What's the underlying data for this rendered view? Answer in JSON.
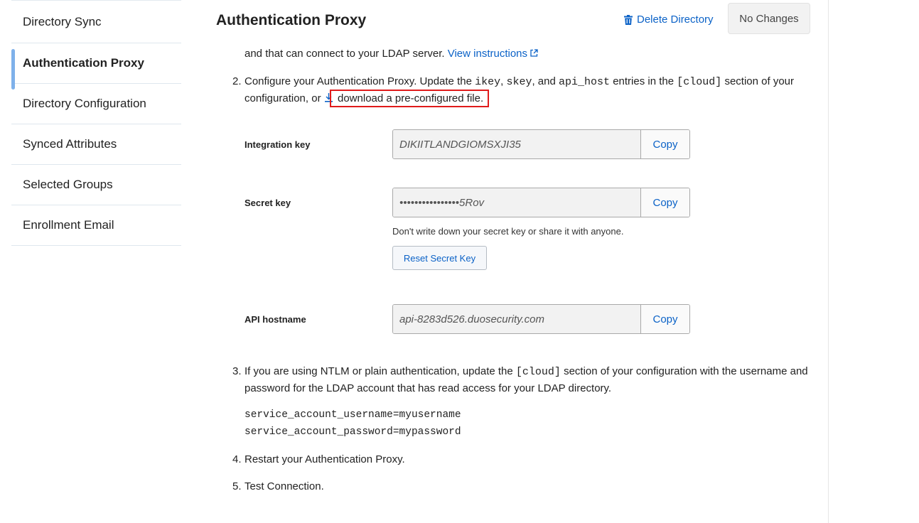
{
  "sidebar": {
    "items": [
      {
        "label": "Directory Sync"
      },
      {
        "label": "Authentication Proxy"
      },
      {
        "label": "Directory Configuration"
      },
      {
        "label": "Synced Attributes"
      },
      {
        "label": "Selected Groups"
      },
      {
        "label": "Enrollment Email"
      }
    ],
    "active_index": 1
  },
  "header": {
    "title": "Authentication Proxy",
    "delete_label": "Delete Directory",
    "no_changes_label": "No Changes"
  },
  "step1": {
    "tail_text": "and that can connect to your LDAP server.",
    "link_text": "View instructions"
  },
  "step2": {
    "number": "2.",
    "text_a": "Configure your Authentication Proxy. Update the",
    "code_ikey": "ikey",
    "comma1": ",",
    "code_skey": "skey",
    "text_and": ", and",
    "code_api_host": "api_host",
    "text_entries": "entries in the",
    "code_cloud": "[cloud]",
    "text_section": "section of your",
    "text_config": "configuration, or",
    "download_link": "download a pre-configured file."
  },
  "fields": {
    "integration_key": {
      "label": "Integration key",
      "value": "DIKIITLANDGIOMSXJI35",
      "copy": "Copy"
    },
    "secret_key": {
      "label": "Secret key",
      "value": "••••••••••••••••5Rov",
      "copy": "Copy"
    },
    "api_hostname": {
      "label": "API hostname",
      "value": "api-8283d526.duosecurity.com",
      "copy": "Copy"
    }
  },
  "secret_hint": "Don't write down your secret key or share it with anyone.",
  "reset_label": "Reset Secret Key",
  "step3": {
    "number": "3.",
    "text_a": "If you are using NTLM or plain authentication, update the",
    "code_cloud": "[cloud]",
    "text_b": "section of your configuration with the username and",
    "text_c": "password for the LDAP account that has read access for your LDAP directory.",
    "code_line1": "service_account_username=myusername",
    "code_line2": "service_account_password=mypassword"
  },
  "step4": {
    "number": "4.",
    "text": "Restart your Authentication Proxy."
  },
  "step5": {
    "number": "5.",
    "link": "Test Connection."
  },
  "colors": {
    "link": "#0b62c7",
    "highlight": "#e01b1b",
    "active_bar": "#7fb1ea"
  }
}
